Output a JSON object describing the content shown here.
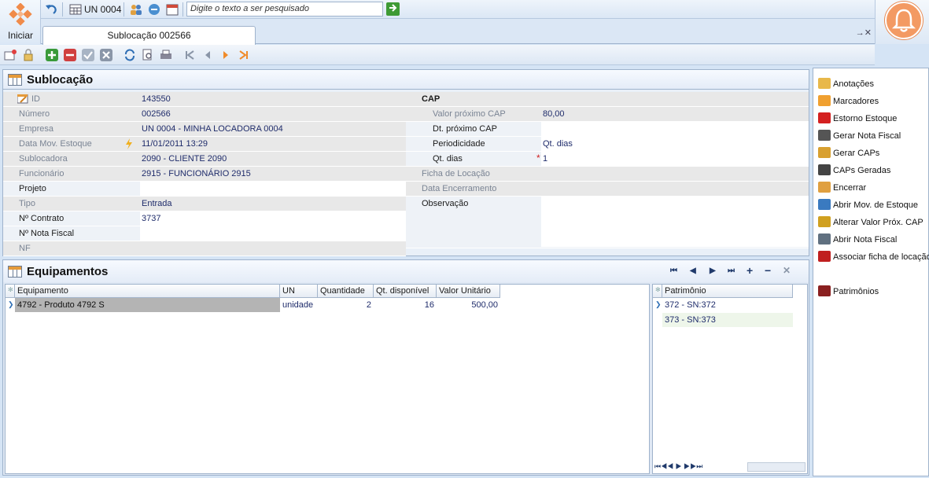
{
  "app": {
    "start_label": "Iniciar",
    "unit_label": "UN 0004",
    "search_placeholder": "Digite o texto a ser pesquisado"
  },
  "tab": {
    "title": "Sublocação 002566",
    "close_glyph": "→✕"
  },
  "form": {
    "title": "Sublocação",
    "left": [
      {
        "label": "ID",
        "value": "143550"
      },
      {
        "label": "Número",
        "value": "002566"
      },
      {
        "label": "Empresa",
        "value": "UN 0004 - MINHA LOCADORA 0004"
      },
      {
        "label": "Data Mov. Estoque",
        "value": "11/01/2011 13:29"
      },
      {
        "label": "Sublocadora",
        "value": "2090 - CLIENTE  2090"
      },
      {
        "label": "Funcionário",
        "value": "2915 - FUNCIONÁRIO  2915"
      },
      {
        "label": "Projeto",
        "value": ""
      },
      {
        "label": "Tipo",
        "value": "Entrada"
      },
      {
        "label": "Nº Contrato",
        "value": "3737"
      },
      {
        "label": "Nº Nota Fiscal",
        "value": ""
      },
      {
        "label": "NF",
        "value": ""
      }
    ],
    "right": {
      "cap_heading": "CAP",
      "valor_proximo_cap_label": "Valor próximo CAP",
      "valor_proximo_cap": "80,00",
      "dt_proximo_cap_label": "Dt. próximo CAP",
      "dt_proximo_cap": "",
      "periodicidade_label": "Periodicidade",
      "periodicidade": "Qt. dias",
      "qt_dias_label": "Qt. dias",
      "qt_dias_required": "*",
      "qt_dias": "1",
      "ficha_locacao_label": "Ficha de Locação",
      "ficha_locacao": "",
      "data_encerramento_label": "Data Encerramento",
      "data_encerramento": "",
      "observacao_label": "Observação",
      "observacao": ""
    }
  },
  "equipments": {
    "title": "Equipamentos",
    "columns": [
      "Equipamento",
      "UN",
      "Quantidade",
      "Qt. disponível",
      "Valor Unitário"
    ],
    "rows": [
      {
        "equipamento": "4792 - Produto 4792 S",
        "un": "unidade",
        "quantidade": "2",
        "qt_disponivel": "16",
        "valor_unitario": "500,00"
      }
    ],
    "patrimonio_header": "Patrimônio",
    "patrimonios": [
      "372 - SN:372",
      "373 - SN:373"
    ],
    "nav": [
      "⏮",
      "◀",
      "▶",
      "⏭",
      "+",
      "−",
      "✕"
    ],
    "bottom_nav": "⏮◀◀ ▶ ▶▶⏭"
  },
  "side_actions": [
    {
      "label": "Anotações",
      "icon": "notes-icon",
      "color": "#e8b84a"
    },
    {
      "label": "Marcadores",
      "icon": "tag-icon",
      "color": "#f0a030"
    },
    {
      "label": "Estorno Estoque",
      "icon": "undo-stock-icon",
      "color": "#d42020"
    },
    {
      "label": "Gerar Nota Fiscal",
      "icon": "invoice-icon",
      "color": "#555555"
    },
    {
      "label": "Gerar CAPs",
      "icon": "coins-icon",
      "color": "#d8a030"
    },
    {
      "label": "CAPs Geradas",
      "icon": "documents-icon",
      "color": "#444444"
    },
    {
      "label": "Encerrar",
      "icon": "handshake-icon",
      "color": "#e0a040"
    },
    {
      "label": "Abrir Mov. de Estoque",
      "icon": "open-stock-icon",
      "color": "#3a7ac0"
    },
    {
      "label": "Alterar Valor Próx. CAP",
      "icon": "edit-value-icon",
      "color": "#d0a020"
    },
    {
      "label": "Abrir Nota Fiscal",
      "icon": "open-invoice-icon",
      "color": "#607080"
    },
    {
      "label": "Associar ficha de locação",
      "icon": "link-arrow-icon",
      "color": "#c02020"
    },
    {
      "label": "Patrimônios",
      "icon": "assets-icon",
      "color": "#8a2020"
    }
  ]
}
